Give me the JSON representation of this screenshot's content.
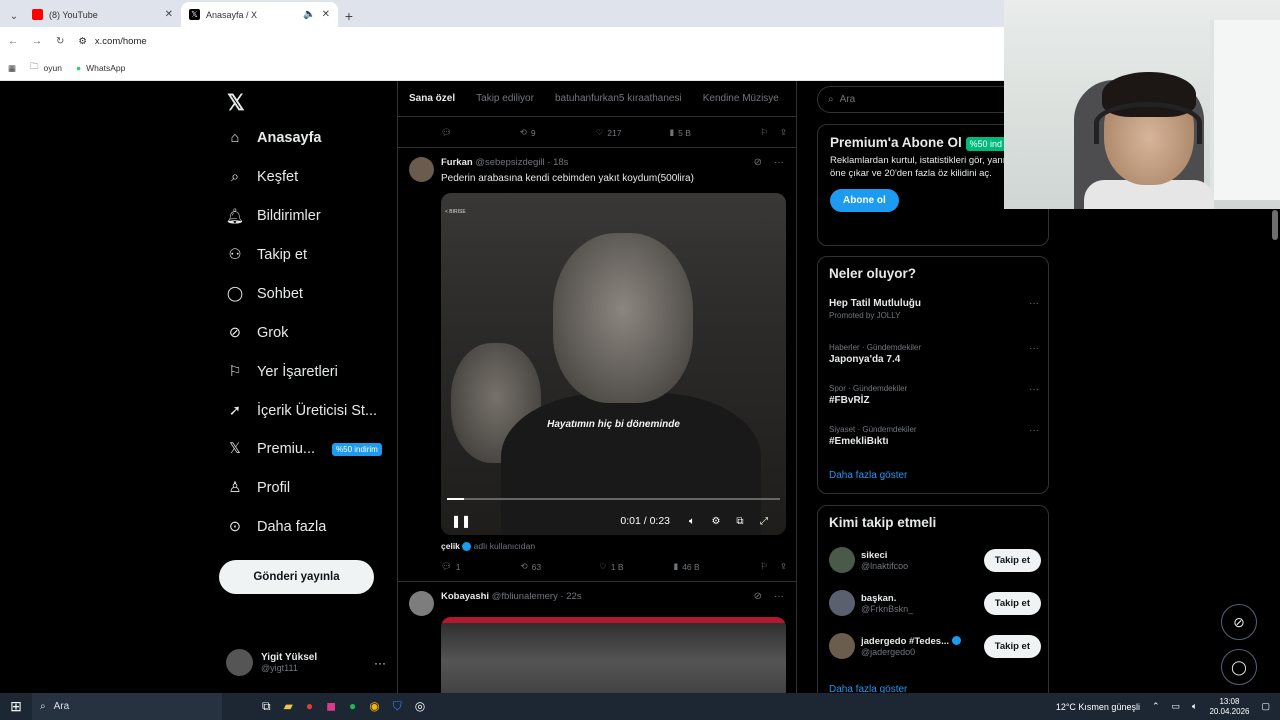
{
  "browser": {
    "tabs": [
      {
        "title": "(8) YouTube",
        "color": "#ff0000"
      },
      {
        "title": "Anasayfa / X",
        "color": "#000000"
      }
    ],
    "url": "x.com/home",
    "bookmarks": [
      "oyun",
      "WhatsApp"
    ]
  },
  "nav": {
    "items": [
      "Anasayfa",
      "Keşfet",
      "Bildirimler",
      "Takip et",
      "Sohbet",
      "Grok",
      "Yer İşaretleri",
      "İçerik Üreticisi St...",
      "Premiu...",
      "Profil",
      "Daha fazla"
    ],
    "premium_badge": "%50 indirim",
    "post_button": "Gönderi yayınla",
    "user_name": "Yigit Yüksel",
    "user_handle": "@yigt111"
  },
  "feed": {
    "tabs": [
      "Sana özel",
      "Takip ediliyor",
      "batuhanfurkan5 kıraathanesi",
      "Kendine Müzisye"
    ],
    "top_actions": {
      "retweets": "9",
      "likes": "217",
      "views": "5 B"
    },
    "tweet1": {
      "name": "Furkan",
      "handle": "@sebepsizdegill · 18s",
      "text": "Pederin arabasına kendi cebimden yakıt koydum(500lira)",
      "video_tag": "< BIRISE",
      "subtitle": "Hayatımın hiç bi döneminde",
      "time": "0:01 / 0:23",
      "progress": 0.05,
      "attr_name": "çelik",
      "attr_rest": "adlı kullanıcıdan",
      "replies": "1",
      "retweets": "63",
      "likes": "1 B",
      "views": "46 B"
    },
    "tweet2": {
      "name": "Kobayashi",
      "handle": "@fbliunalemery · 22s"
    }
  },
  "sidebar": {
    "search_placeholder": "Ara",
    "premium_title": "Premium'a Abone Ol",
    "premium_badge": "%50 ind",
    "premium_desc": "Reklamlardan kurtul, istatistikleri gör, yanıtlarını öne çıkar ve 20'den fazla öz kilidini aç.",
    "subscribe": "Abone ol",
    "trends_title": "Neler oluyor?",
    "trends": [
      {
        "meta": "Promoted by JOLLY",
        "title": "Hep Tatil Mutluluğu"
      },
      {
        "meta": "Haberler · Gündemdekiler",
        "title": "Japonya'da 7.4"
      },
      {
        "meta": "Spor · Gündemdekiler",
        "title": "#FBvRİZ"
      },
      {
        "meta": "Siyaset · Gündemdekiler",
        "title": "#EmekliBıktı"
      }
    ],
    "show_more": "Daha fazla göster",
    "who_title": "Kimi takip etmeli",
    "who": [
      {
        "name": "sikeci",
        "handle": "@lnaktifcoo"
      },
      {
        "name": "başkan.",
        "handle": "@FrknBskn_"
      },
      {
        "name": "jadergedo #Tedes...",
        "handle": "@jadergedo0"
      }
    ],
    "follow": "Takip et",
    "show_more2": "Daha fazla göster"
  },
  "taskbar": {
    "search": "Ara",
    "weather": "12°C  Kısmen güneşli",
    "time": "13:08",
    "date": "20.04.2026"
  }
}
